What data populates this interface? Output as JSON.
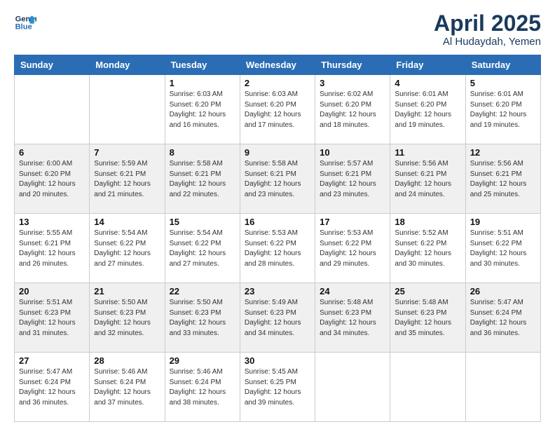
{
  "header": {
    "logo_line1": "General",
    "logo_line2": "Blue",
    "title": "April 2025",
    "subtitle": "Al Hudaydah, Yemen"
  },
  "weekdays": [
    "Sunday",
    "Monday",
    "Tuesday",
    "Wednesday",
    "Thursday",
    "Friday",
    "Saturday"
  ],
  "rows": [
    [
      {
        "day": "",
        "sunrise": "",
        "sunset": "",
        "daylight": ""
      },
      {
        "day": "",
        "sunrise": "",
        "sunset": "",
        "daylight": ""
      },
      {
        "day": "1",
        "sunrise": "Sunrise: 6:03 AM",
        "sunset": "Sunset: 6:20 PM",
        "daylight": "Daylight: 12 hours and 16 minutes."
      },
      {
        "day": "2",
        "sunrise": "Sunrise: 6:03 AM",
        "sunset": "Sunset: 6:20 PM",
        "daylight": "Daylight: 12 hours and 17 minutes."
      },
      {
        "day": "3",
        "sunrise": "Sunrise: 6:02 AM",
        "sunset": "Sunset: 6:20 PM",
        "daylight": "Daylight: 12 hours and 18 minutes."
      },
      {
        "day": "4",
        "sunrise": "Sunrise: 6:01 AM",
        "sunset": "Sunset: 6:20 PM",
        "daylight": "Daylight: 12 hours and 19 minutes."
      },
      {
        "day": "5",
        "sunrise": "Sunrise: 6:01 AM",
        "sunset": "Sunset: 6:20 PM",
        "daylight": "Daylight: 12 hours and 19 minutes."
      }
    ],
    [
      {
        "day": "6",
        "sunrise": "Sunrise: 6:00 AM",
        "sunset": "Sunset: 6:20 PM",
        "daylight": "Daylight: 12 hours and 20 minutes."
      },
      {
        "day": "7",
        "sunrise": "Sunrise: 5:59 AM",
        "sunset": "Sunset: 6:21 PM",
        "daylight": "Daylight: 12 hours and 21 minutes."
      },
      {
        "day": "8",
        "sunrise": "Sunrise: 5:58 AM",
        "sunset": "Sunset: 6:21 PM",
        "daylight": "Daylight: 12 hours and 22 minutes."
      },
      {
        "day": "9",
        "sunrise": "Sunrise: 5:58 AM",
        "sunset": "Sunset: 6:21 PM",
        "daylight": "Daylight: 12 hours and 23 minutes."
      },
      {
        "day": "10",
        "sunrise": "Sunrise: 5:57 AM",
        "sunset": "Sunset: 6:21 PM",
        "daylight": "Daylight: 12 hours and 23 minutes."
      },
      {
        "day": "11",
        "sunrise": "Sunrise: 5:56 AM",
        "sunset": "Sunset: 6:21 PM",
        "daylight": "Daylight: 12 hours and 24 minutes."
      },
      {
        "day": "12",
        "sunrise": "Sunrise: 5:56 AM",
        "sunset": "Sunset: 6:21 PM",
        "daylight": "Daylight: 12 hours and 25 minutes."
      }
    ],
    [
      {
        "day": "13",
        "sunrise": "Sunrise: 5:55 AM",
        "sunset": "Sunset: 6:21 PM",
        "daylight": "Daylight: 12 hours and 26 minutes."
      },
      {
        "day": "14",
        "sunrise": "Sunrise: 5:54 AM",
        "sunset": "Sunset: 6:22 PM",
        "daylight": "Daylight: 12 hours and 27 minutes."
      },
      {
        "day": "15",
        "sunrise": "Sunrise: 5:54 AM",
        "sunset": "Sunset: 6:22 PM",
        "daylight": "Daylight: 12 hours and 27 minutes."
      },
      {
        "day": "16",
        "sunrise": "Sunrise: 5:53 AM",
        "sunset": "Sunset: 6:22 PM",
        "daylight": "Daylight: 12 hours and 28 minutes."
      },
      {
        "day": "17",
        "sunrise": "Sunrise: 5:53 AM",
        "sunset": "Sunset: 6:22 PM",
        "daylight": "Daylight: 12 hours and 29 minutes."
      },
      {
        "day": "18",
        "sunrise": "Sunrise: 5:52 AM",
        "sunset": "Sunset: 6:22 PM",
        "daylight": "Daylight: 12 hours and 30 minutes."
      },
      {
        "day": "19",
        "sunrise": "Sunrise: 5:51 AM",
        "sunset": "Sunset: 6:22 PM",
        "daylight": "Daylight: 12 hours and 30 minutes."
      }
    ],
    [
      {
        "day": "20",
        "sunrise": "Sunrise: 5:51 AM",
        "sunset": "Sunset: 6:23 PM",
        "daylight": "Daylight: 12 hours and 31 minutes."
      },
      {
        "day": "21",
        "sunrise": "Sunrise: 5:50 AM",
        "sunset": "Sunset: 6:23 PM",
        "daylight": "Daylight: 12 hours and 32 minutes."
      },
      {
        "day": "22",
        "sunrise": "Sunrise: 5:50 AM",
        "sunset": "Sunset: 6:23 PM",
        "daylight": "Daylight: 12 hours and 33 minutes."
      },
      {
        "day": "23",
        "sunrise": "Sunrise: 5:49 AM",
        "sunset": "Sunset: 6:23 PM",
        "daylight": "Daylight: 12 hours and 34 minutes."
      },
      {
        "day": "24",
        "sunrise": "Sunrise: 5:48 AM",
        "sunset": "Sunset: 6:23 PM",
        "daylight": "Daylight: 12 hours and 34 minutes."
      },
      {
        "day": "25",
        "sunrise": "Sunrise: 5:48 AM",
        "sunset": "Sunset: 6:23 PM",
        "daylight": "Daylight: 12 hours and 35 minutes."
      },
      {
        "day": "26",
        "sunrise": "Sunrise: 5:47 AM",
        "sunset": "Sunset: 6:24 PM",
        "daylight": "Daylight: 12 hours and 36 minutes."
      }
    ],
    [
      {
        "day": "27",
        "sunrise": "Sunrise: 5:47 AM",
        "sunset": "Sunset: 6:24 PM",
        "daylight": "Daylight: 12 hours and 36 minutes."
      },
      {
        "day": "28",
        "sunrise": "Sunrise: 5:46 AM",
        "sunset": "Sunset: 6:24 PM",
        "daylight": "Daylight: 12 hours and 37 minutes."
      },
      {
        "day": "29",
        "sunrise": "Sunrise: 5:46 AM",
        "sunset": "Sunset: 6:24 PM",
        "daylight": "Daylight: 12 hours and 38 minutes."
      },
      {
        "day": "30",
        "sunrise": "Sunrise: 5:45 AM",
        "sunset": "Sunset: 6:25 PM",
        "daylight": "Daylight: 12 hours and 39 minutes."
      },
      {
        "day": "",
        "sunrise": "",
        "sunset": "",
        "daylight": ""
      },
      {
        "day": "",
        "sunrise": "",
        "sunset": "",
        "daylight": ""
      },
      {
        "day": "",
        "sunrise": "",
        "sunset": "",
        "daylight": ""
      }
    ]
  ]
}
